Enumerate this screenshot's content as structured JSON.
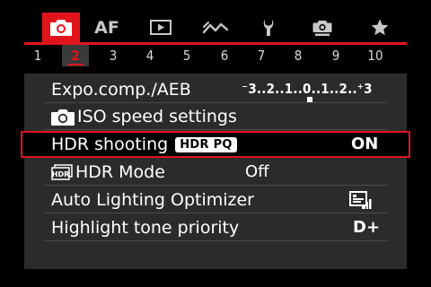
{
  "tabs": [
    {
      "name": "shooting",
      "label": "",
      "icon": "camera-icon",
      "active": true
    },
    {
      "name": "af",
      "label": "AF",
      "icon": "",
      "active": false
    },
    {
      "name": "playback",
      "label": "",
      "icon": "play-icon",
      "active": false
    },
    {
      "name": "network",
      "label": "",
      "icon": "wireless-icon",
      "active": false
    },
    {
      "name": "setup",
      "label": "",
      "icon": "wrench-icon",
      "active": false
    },
    {
      "name": "custom",
      "label": "",
      "icon": "custom-camera-icon",
      "active": false
    },
    {
      "name": "mymenu",
      "label": "",
      "icon": "star-icon",
      "active": false
    }
  ],
  "pages": [
    "1",
    "2",
    "3",
    "4",
    "5",
    "6",
    "7",
    "8",
    "9",
    "10"
  ],
  "active_page": "2",
  "menu": {
    "expo": {
      "label": "Expo.comp./AEB",
      "scale": "⁻3..2..1..0..1..2..⁺3"
    },
    "iso": {
      "label": "ISO speed settings",
      "icon": "camera-icon"
    },
    "hdr_shooting": {
      "label": "HDR shooting",
      "badge": "HDR PQ",
      "value": "ON"
    },
    "hdr_mode": {
      "label": "HDR Mode",
      "icon": "hdr-icon",
      "value": "Off"
    },
    "alo": {
      "label": "Auto Lighting Optimizer",
      "value_icon": "auto-lighting-optimizer-icon"
    },
    "htp": {
      "label": "Highlight tone priority",
      "value": "D+"
    }
  },
  "colors": {
    "accent": "#e1141c",
    "list_bg": "#2b2b2b",
    "selected_bg": "#000000"
  }
}
